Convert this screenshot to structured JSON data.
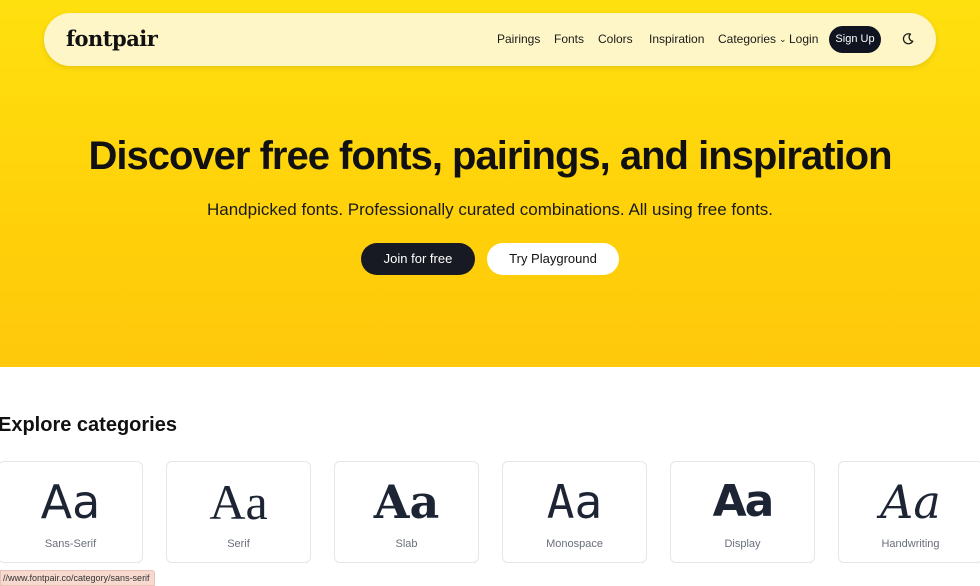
{
  "nav": {
    "logo": "fontpair",
    "items": [
      "Pairings",
      "Fonts",
      "Colors",
      "Inspiration"
    ],
    "categories_label": "Categories",
    "login_label": "Login",
    "signup_label": "Sign Up"
  },
  "hero": {
    "title": "Discover free fonts, pairings, and inspiration",
    "subtitle": "Handpicked fonts. Professionally curated combinations. All using free fonts.",
    "join_label": "Join for free",
    "playground_label": "Try Playground"
  },
  "categories": {
    "title": "Explore categories",
    "items": [
      {
        "sample": "Aa",
        "label": "Sans-Serif"
      },
      {
        "sample": "Aa",
        "label": "Serif"
      },
      {
        "sample": "Aa",
        "label": "Slab"
      },
      {
        "sample": "Aa",
        "label": "Monospace"
      },
      {
        "sample": "Aa",
        "label": "Display"
      },
      {
        "sample": "Aa",
        "label": "Handwriting"
      }
    ]
  },
  "status_bar": {
    "url": "//www.fontpair.co/category/sans-serif"
  },
  "colors": {
    "hero_yellow": "#ffd20a",
    "dark_button": "#171a22"
  }
}
